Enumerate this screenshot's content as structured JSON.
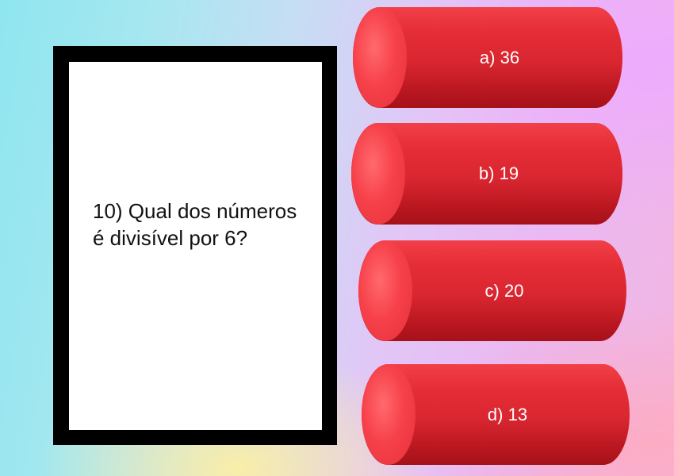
{
  "question": "10) Qual dos números é divisível por 6?",
  "options": [
    {
      "label": "a) 36"
    },
    {
      "label": "b) 19"
    },
    {
      "label": "c) 20"
    },
    {
      "label": "d) 13"
    }
  ]
}
